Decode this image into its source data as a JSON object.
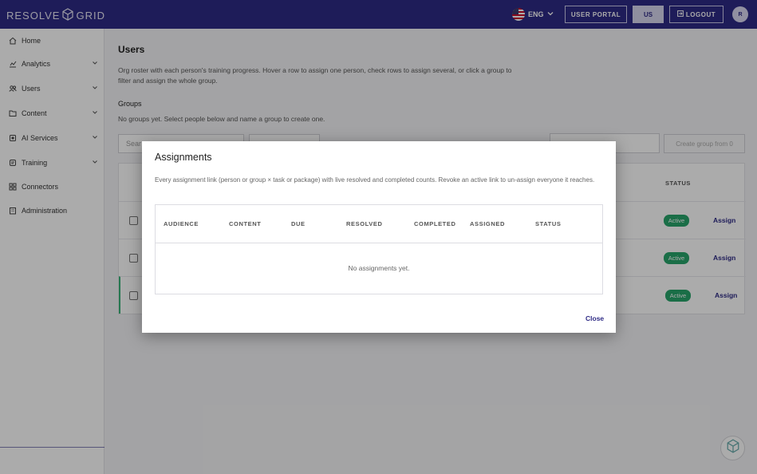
{
  "brand": {
    "name_left": "RESOLVE",
    "name_right": "GRID"
  },
  "header": {
    "language": "ENG",
    "user_portal": "USER PORTAL",
    "us_button": "US",
    "logout": "LOGOUT",
    "avatar_initial": "R"
  },
  "sidebar": {
    "items": [
      {
        "label": "Home",
        "icon": "home-icon",
        "expandable": false
      },
      {
        "label": "Analytics",
        "icon": "analytics-icon",
        "expandable": true
      },
      {
        "label": "Users",
        "icon": "users-icon",
        "expandable": true
      },
      {
        "label": "Content",
        "icon": "folder-icon",
        "expandable": true
      },
      {
        "label": "AI Services",
        "icon": "chip-icon",
        "expandable": true
      },
      {
        "label": "Training",
        "icon": "training-icon",
        "expandable": true
      },
      {
        "label": "Connectors",
        "icon": "grid-icon",
        "expandable": false
      },
      {
        "label": "Administration",
        "icon": "building-icon",
        "expandable": false
      }
    ]
  },
  "main": {
    "title": "Users",
    "intro": "Org roster with each person's training progress. Hover a row to assign one person, check rows to assign several, or click a group to filter and assign the whole group.",
    "groups_heading": "Groups",
    "groups_empty": "No groups yet. Select people below and name a group to create one.",
    "search_placeholder": "Sear",
    "create_group": "Create group from 0",
    "table": {
      "status_header": "STATUS",
      "rows": [
        {
          "status": "Active",
          "action": "Assign",
          "selected": false
        },
        {
          "status": "Active",
          "action": "Assign",
          "selected": false
        },
        {
          "status": "Active",
          "action": "Assign",
          "selected": true
        }
      ]
    }
  },
  "modal": {
    "title": "Assignments",
    "description": "Every assignment link (person or group × task or package) with live resolved and completed counts. Revoke an active link to un-assign everyone it reaches.",
    "columns": [
      "AUDIENCE",
      "CONTENT",
      "DUE",
      "RESOLVED",
      "COMPLETED",
      "ASSIGNED",
      "STATUS"
    ],
    "empty_text": "No assignments yet.",
    "close_label": "Close"
  },
  "colors": {
    "brand": "#2e2a85",
    "active_badge": "#28a56b",
    "selected_row_marker": "#3bb37a"
  }
}
